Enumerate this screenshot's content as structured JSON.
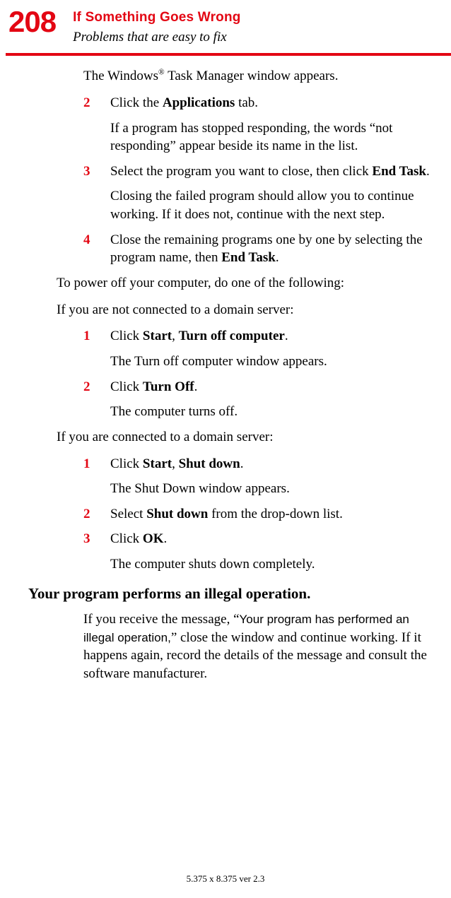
{
  "header": {
    "page_number": "208",
    "chapter_title": "If Something Goes Wrong",
    "section_title": "Problems that are easy to fix"
  },
  "intro_line_pre": "The Windows",
  "intro_line_sup": "®",
  "intro_line_post": " Task Manager window appears.",
  "listA": {
    "s2": {
      "num": "2",
      "t1a": "Click the ",
      "t1b": "Applications",
      "t1c": " tab.",
      "t2": "If a program has stopped responding, the words “not responding” appear beside its name in the list."
    },
    "s3": {
      "num": "3",
      "t1a": "Select the program you want to close, then click ",
      "t1b": "End Task",
      "t1c": ".",
      "t2": "Closing the failed program should allow you to continue working. If it does not, continue with the next step."
    },
    "s4": {
      "num": "4",
      "t1a": "Close the remaining programs one by one by selecting the program name, then ",
      "t1b": "End Task",
      "t1c": "."
    }
  },
  "mid1": "To power off your computer, do one of the following:",
  "mid2": "If you are not connected to a domain server:",
  "listB": {
    "s1": {
      "num": "1",
      "t1a": "Click ",
      "t1b": "Start",
      "t1c": ", ",
      "t1d": "Turn off computer",
      "t1e": ".",
      "t2": "The Turn off computer window appears."
    },
    "s2": {
      "num": "2",
      "t1a": "Click ",
      "t1b": "Turn Off",
      "t1c": ".",
      "t2": "The computer turns off."
    }
  },
  "mid3": "If you are connected to a domain server:",
  "listC": {
    "s1": {
      "num": "1",
      "t1a": "Click ",
      "t1b": "Start",
      "t1c": ", ",
      "t1d": "Shut down",
      "t1e": ".",
      "t2": "The Shut Down window appears."
    },
    "s2": {
      "num": "2",
      "t1a": "Select ",
      "t1b": "Shut down",
      "t1c": " from the drop-down list."
    },
    "s3": {
      "num": "3",
      "t1a": "Click ",
      "t1b": "OK",
      "t1c": ".",
      "t2": "The computer shuts down completely."
    }
  },
  "subhead": "Your program performs an illegal operation.",
  "final": {
    "a": "If you receive the message, “",
    "msg": "Your program has performed an illegal operation,",
    "b": "” close the window and continue working. If it happens again, record the details of the message and consult the software manufacturer."
  },
  "footer": "5.375 x 8.375 ver 2.3"
}
